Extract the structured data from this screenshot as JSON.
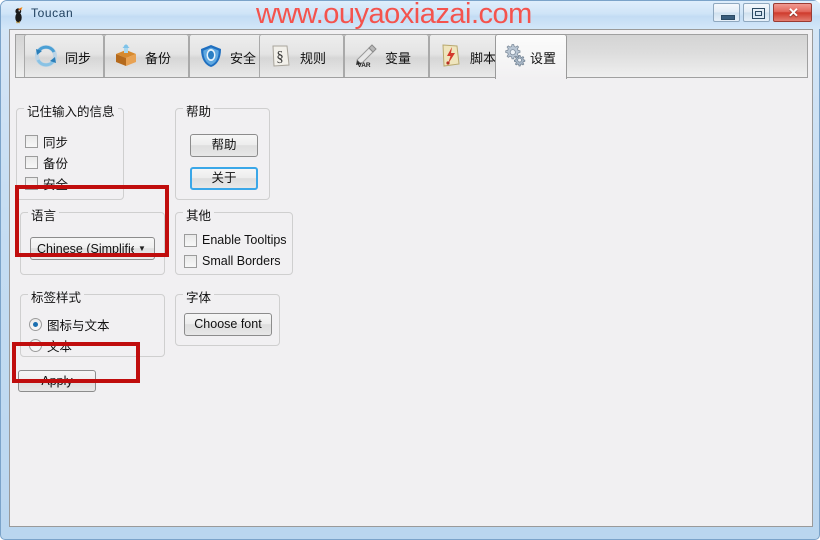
{
  "window": {
    "title": "Toucan",
    "icon": "toucan-icon",
    "watermark": "www.ouyaoxiazai.com",
    "controls": {
      "minimize": "–",
      "maximize": "□",
      "close": "✕"
    }
  },
  "tabs": [
    {
      "label": "同步",
      "icon": "sync-icon",
      "active": false
    },
    {
      "label": "备份",
      "icon": "backup-box-icon",
      "active": false
    },
    {
      "label": "安全",
      "icon": "shield-icon",
      "active": false
    },
    {
      "label": "规则",
      "icon": "rules-icon",
      "active": false
    },
    {
      "label": "变量",
      "icon": "variable-icon",
      "active": false
    },
    {
      "label": "脚本",
      "icon": "script-icon",
      "active": false
    },
    {
      "label": "设置",
      "icon": "settings-gears-icon",
      "active": true
    }
  ],
  "groups": {
    "remember": {
      "title": "记住输入的信息",
      "items": [
        {
          "label": "同步",
          "checked": false
        },
        {
          "label": "备份",
          "checked": false
        },
        {
          "label": "安全",
          "checked": false
        }
      ]
    },
    "help": {
      "title": "帮助",
      "help_button": "帮助",
      "about_button": "关于"
    },
    "language": {
      "title": "语言",
      "selected": "Chinese (Simplified",
      "arrow": "▼"
    },
    "other": {
      "title": "其他",
      "items": [
        {
          "label": "Enable Tooltips",
          "checked": false
        },
        {
          "label": "Small Borders",
          "checked": false
        }
      ]
    },
    "labelstyle": {
      "title": "标签样式",
      "options": [
        {
          "label": "图标与文本",
          "checked": true
        },
        {
          "label": "文本",
          "checked": false
        }
      ]
    },
    "font": {
      "title": "字体",
      "choose_button": "Choose font"
    }
  },
  "apply_button": "Apply",
  "colors": {
    "annotation": "#c00d0d",
    "watermark": "#f4534d",
    "focus": "#3aa7e8",
    "titlebar": "#cfe4f7"
  }
}
